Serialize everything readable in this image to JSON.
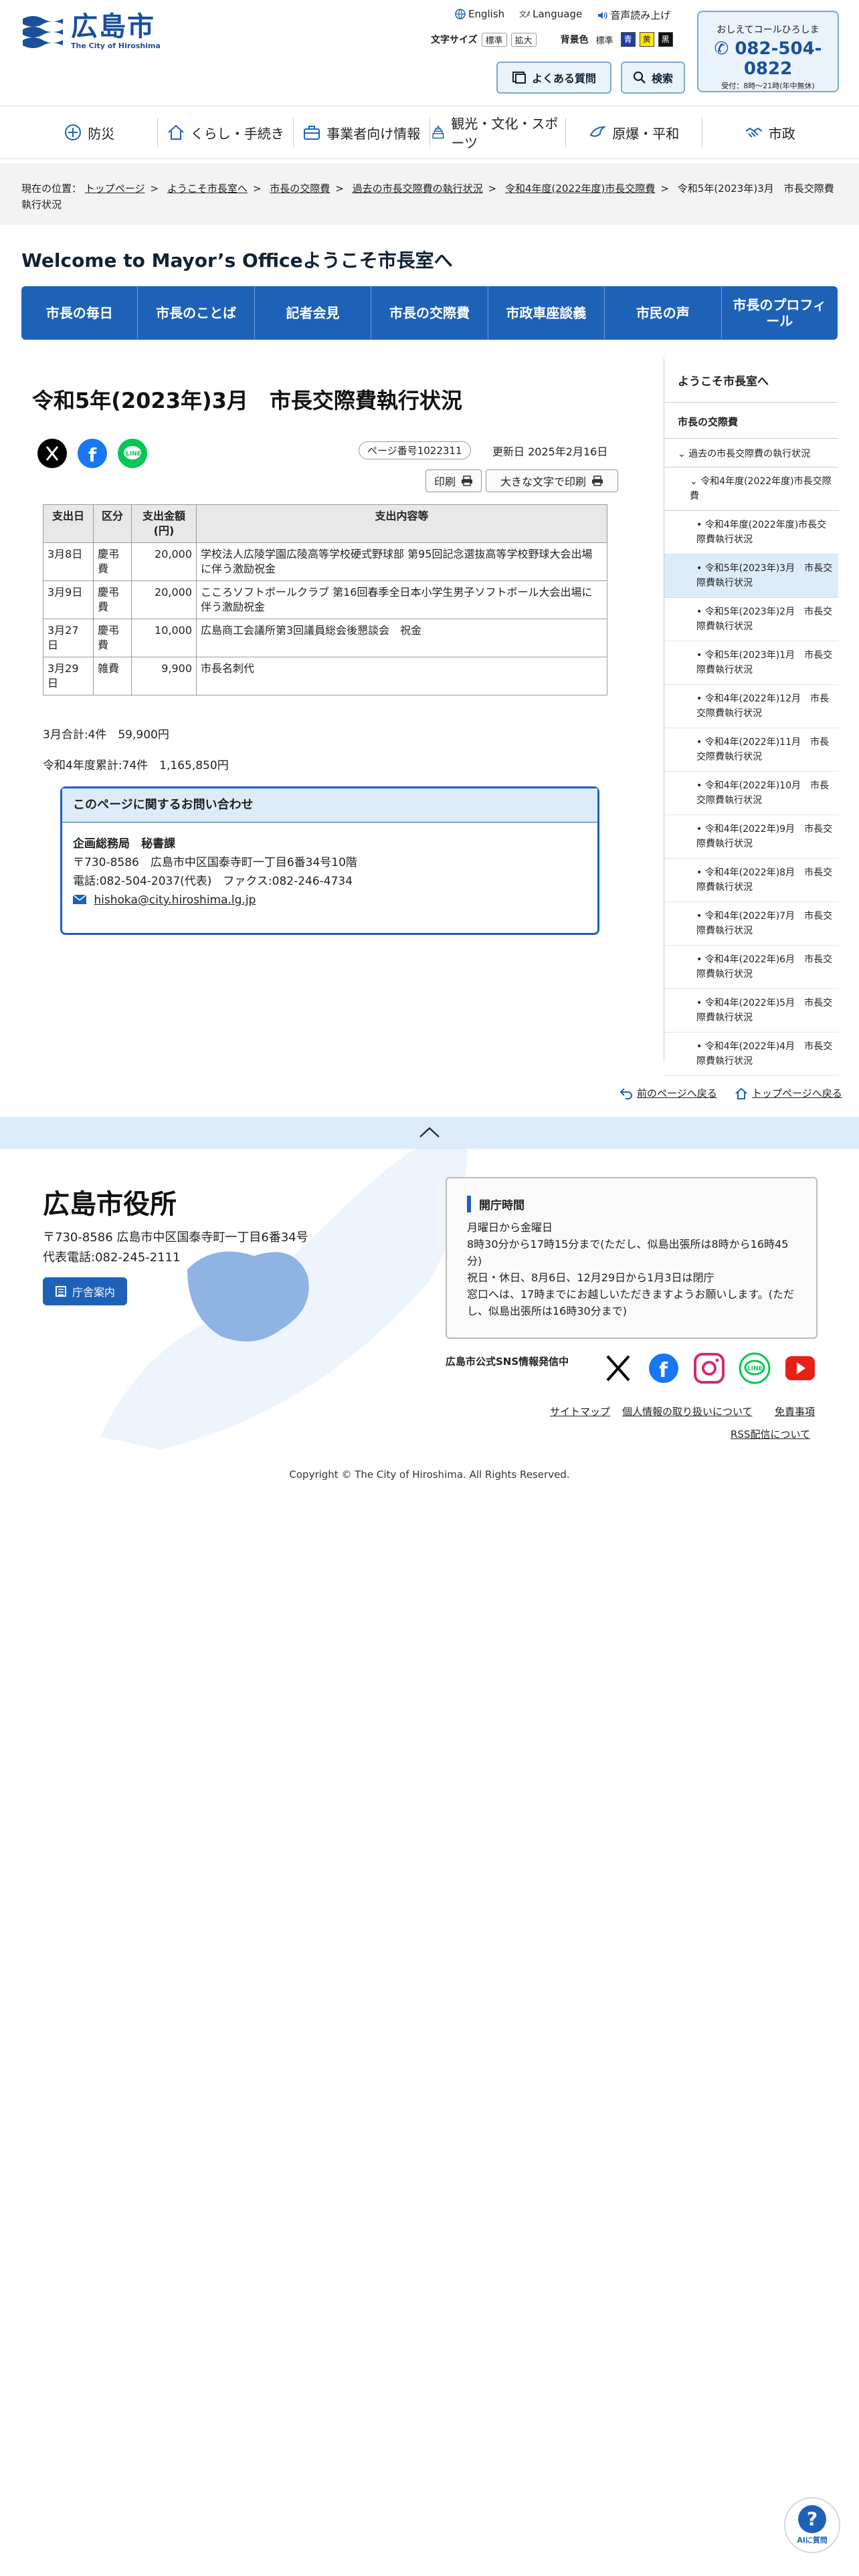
{
  "header": {
    "logo_text": "広島市",
    "logo_sub": "The City of Hiroshima",
    "english": "English",
    "language": "Language",
    "voice": "音声読み上げ",
    "text_size_label": "文字サイズ",
    "size_standard": "標準",
    "size_large": "拡大",
    "bg_color_label": "背景色",
    "bg_standard": "標準",
    "bg_blue": "青",
    "bg_yellow": "黄",
    "bg_black": "黒",
    "faq_button": "よくある質問",
    "search_button": "検索",
    "call_title": "おしえてコールひろしま",
    "call_number": "082-504-0822",
    "call_hours": "受付：8時～21時(年中無休)"
  },
  "global_nav": [
    {
      "label": "防災",
      "icon": "bousai-icon"
    },
    {
      "label": "くらし・手続き",
      "icon": "house-icon"
    },
    {
      "label": "事業者向け情報",
      "icon": "briefcase-icon"
    },
    {
      "label": "観光・文化・スポーツ",
      "icon": "landmark-icon"
    },
    {
      "label": "原爆・平和",
      "icon": "dove-icon"
    },
    {
      "label": "市政",
      "icon": "handshake-icon"
    }
  ],
  "breadcrumb": {
    "prefix": "現在の位置：",
    "items": [
      "トップページ",
      "ようこそ市長室へ",
      "市長の交際費",
      "過去の市長交際費の執行状況",
      "令和4年度(2022年度)市長交際費"
    ],
    "current": "令和5年(2023年)3月　市長交際費執行状況"
  },
  "mayor_office": {
    "title": "Welcome to Mayor’s Officeようこそ市長室へ",
    "nav": [
      "市長の毎日",
      "市長のことば",
      "記者会見",
      "市長の交際費",
      "市政車座談義",
      "市民の声",
      "市長のプロフィール"
    ]
  },
  "article": {
    "title": "令和5年(2023年)3月　市長交際費執行状況",
    "page_id": "ページ番号1022311",
    "updated": "更新日 2025年2月16日",
    "print": "印刷",
    "print_large": "大きな文字で印刷",
    "table": {
      "headers": [
        "支出日",
        "区分",
        "支出金額(円)",
        "支出内容等"
      ],
      "rows": [
        [
          "3月8日",
          "慶弔費",
          "20,000",
          "学校法人広陵学園広陵高等学校硬式野球部 第95回記念選抜高等学校野球大会出場に伴う激励祝金"
        ],
        [
          "3月9日",
          "慶弔費",
          "20,000",
          "こころソフトボールクラブ 第16回春季全日本小学生男子ソフトボール大会出場に伴う激励祝金"
        ],
        [
          "3月27日",
          "慶弔費",
          "10,000",
          "広島商工会議所第3回議員総会後懇談会　祝金"
        ],
        [
          "3月29日",
          "雑費",
          "9,900",
          "市長名刺代"
        ]
      ]
    },
    "month_total": "3月合計:4件　59,900円",
    "year_total": "令和4年度累計:74件　1,165,850円",
    "contact": {
      "heading": "このページに関するお問い合わせ",
      "dept": "企画総務局　秘書課",
      "address": "〒730-8586　広島市中区国泰寺町一丁目6番34号10階",
      "phone": "電話:082-504-2037(代表)　ファクス:082-246-4734",
      "email": "hishoka@city.hiroshima.lg.jp"
    }
  },
  "side_nav": {
    "top": "ようこそ市長室へ",
    "level1": "市長の交際費",
    "level2": "過去の市長交際費の執行状況",
    "level3": "令和4年度(2022年度)市長交際費",
    "items": [
      "令和4年度(2022年度)市長交際費執行状況",
      "令和5年(2023年)3月　市長交際費執行状況",
      "令和5年(2023年)2月　市長交際費執行状況",
      "令和5年(2023年)1月　市長交際費執行状況",
      "令和4年(2022年)12月　市長交際費執行状況",
      "令和4年(2022年)11月　市長交際費執行状況",
      "令和4年(2022年)10月　市長交際費執行状況",
      "令和4年(2022年)9月　市長交際費執行状況",
      "令和4年(2022年)8月　市長交際費執行状況",
      "令和4年(2022年)7月　市長交際費執行状況",
      "令和4年(2022年)6月　市長交際費執行状況",
      "令和4年(2022年)5月　市長交際費執行状況",
      "令和4年(2022年)4月　市長交際費執行状況"
    ]
  },
  "back_links": {
    "prev": "前のページへ戻る",
    "top": "トップページへ戻る"
  },
  "footer": {
    "city_hall": "広島市役所",
    "address": "〒730-8586 広島市中区国泰寺町一丁目6番34号",
    "phone": "代表電話:082-245-2111",
    "guide_button": "庁舎案内",
    "hours_title": "開庁時間",
    "hours_lines": [
      "月曜日から金曜日",
      "8時30分から17時15分まで(ただし、似島出張所は8時から16時45分)",
      "祝日・休日、8月6日、12月29日から1月3日は閉庁",
      "窓口へは、17時までにお越しいただきますようお願いします。(ただし、似島出張所は16時30分まで)"
    ],
    "sns_label": "広島市公式SNS情報発信中",
    "links": [
      "サイトマップ",
      "個人情報の取り扱いについて",
      "免責事項",
      "RSS配信について"
    ],
    "copyright": "Copyright © The City of Hiroshima. All Rights Reserved."
  },
  "ai_faq": "AIに質問",
  "colors": {
    "brand_blue": "#1e62b8",
    "light_blue": "#dcecfb"
  }
}
